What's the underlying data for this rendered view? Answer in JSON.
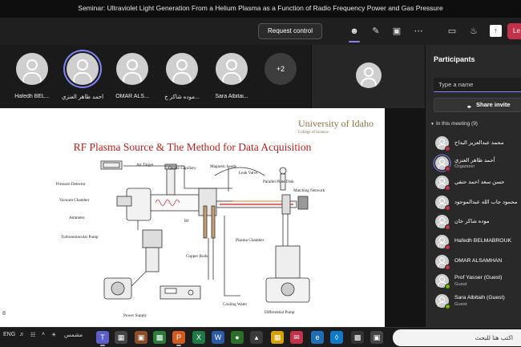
{
  "window": {
    "title": "Seminar: Ultraviolet Light Generation From a Helium Plasma as a Function of Radio Frequency Power and Gas Pressure"
  },
  "toolbar": {
    "request_control": "Request control",
    "leave": "Le"
  },
  "video_strip": {
    "tiles": [
      {
        "name": "Hafedh BEL..."
      },
      {
        "name": "أحمد ظاهر العنزي"
      },
      {
        "name": "OMAR ALS..."
      },
      {
        "name": "موده شاكر خ..."
      },
      {
        "name": "Sara Albitai..."
      }
    ],
    "more_count": "+2"
  },
  "slide": {
    "logo": "University of Idaho",
    "logo_sub": "College of Science",
    "title": "RF Plasma Source & The Method for Data Acquisition",
    "page_number": "8",
    "labels": {
      "air_target": "Air Target",
      "quartz_capillary": "Quartz Capillary",
      "magnetic_heads": "Magnetic heads",
      "leak_valve": "Leak Valve",
      "parallel_plate_disk": "Parallel Plate Disk",
      "matching_network": "Matching Network",
      "pressure_detector": "Pressure Detector",
      "vacuum_chamber": "Vacuum Chamber",
      "ammeter": "Ammeter",
      "turbomolecular_pump": "Turbomolecular Pump",
      "copper_rods": "Copper Rods",
      "plasma_chamber": "Plasma Chamber",
      "cooling_water": "Cooling Water",
      "power_supply": "Power Supply",
      "differential_pump": "Differential Pump",
      "rf": "Rf"
    }
  },
  "participants": {
    "title": "Participants",
    "search_placeholder": "Type a name",
    "share_invite": "Share invite",
    "section": "In this meeting (9)",
    "list": [
      {
        "name": "محمد عبدالعزيز البداح",
        "role": ""
      },
      {
        "name": "أحمد ظاهر العنزي",
        "role": "Organizer"
      },
      {
        "name": "حسن سعد احمد حنفي",
        "role": ""
      },
      {
        "name": "محمود جاب الله عبدالموجود",
        "role": ""
      },
      {
        "name": "موده شاكر خان",
        "role": ""
      },
      {
        "name": "Hafedh BELMABROUK",
        "role": ""
      },
      {
        "name": "OMAR ALSAMHAN",
        "role": ""
      },
      {
        "name": "Prof Yasser (Guest)",
        "role": "Guest"
      },
      {
        "name": "Sara Albitaih (Guest)",
        "role": "Guest"
      }
    ]
  },
  "taskbar": {
    "language": "ENG",
    "weather": "مشمس",
    "search_text": "اكتب هنا للبحث"
  },
  "colors": {
    "accent": "#7f85f5",
    "leave": "#c4314b",
    "slide_title": "#c0201f"
  }
}
